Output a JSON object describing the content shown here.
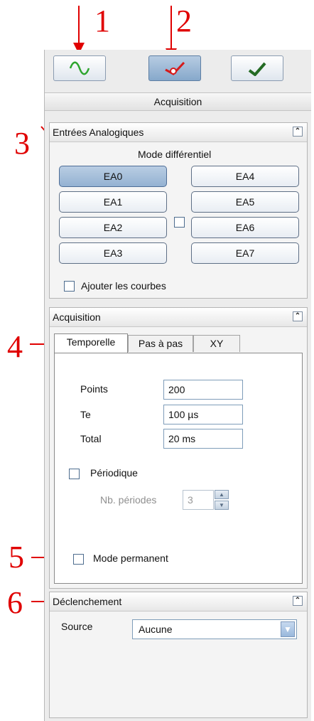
{
  "annotations": [
    "1",
    "2",
    "3",
    "4",
    "5",
    "6"
  ],
  "toolbar": {
    "buttons": [
      {
        "icon": "sine-wave-icon"
      },
      {
        "icon": "instrument-probe-icon"
      },
      {
        "icon": "checkmark-icon"
      }
    ]
  },
  "panel_title": "Acquisition",
  "analog_inputs": {
    "title": "Entrées Analogiques",
    "mode_label": "Mode différentiel",
    "channels_left": [
      "EA0",
      "EA1",
      "EA2",
      "EA3"
    ],
    "channels_right": [
      "EA4",
      "EA5",
      "EA6",
      "EA7"
    ],
    "selected": "EA0",
    "add_curves_label": "Ajouter les courbes"
  },
  "acquisition": {
    "title": "Acquisition",
    "tabs": [
      "Temporelle",
      "Pas à pas",
      "XY"
    ],
    "active_tab": "Temporelle",
    "points_label": "Points",
    "points_value": "200",
    "te_label": "Te",
    "te_value": "100 µs",
    "total_label": "Total",
    "total_value": "20 ms",
    "periodic_label": "Périodique",
    "periods_label": "Nb. périodes",
    "periods_value": "3",
    "permanent_label": "Mode permanent"
  },
  "trigger": {
    "title": "Déclenchement",
    "source_label": "Source",
    "source_value": "Aucune"
  },
  "colors": {
    "annotation": "#e00000",
    "selected_button": "#94b2d2"
  }
}
